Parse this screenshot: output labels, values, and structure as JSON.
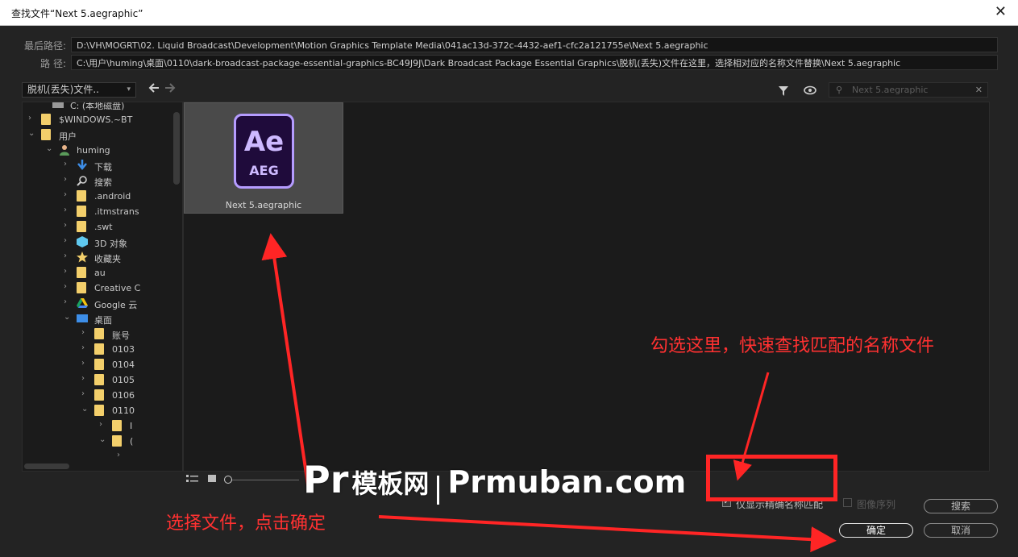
{
  "window": {
    "title": "查找文件“Next 5.aegraphic”",
    "close_glyph": "✕"
  },
  "paths": {
    "last_path_label": "最后路径:",
    "last_path_value": "D:\\VH\\MOGRT\\02. Liquid Broadcast\\Development\\Motion Graphics Template Media\\041ac13d-372c-4432-aef1-cfc2a121755e\\Next 5.aegraphic",
    "path_label": "路 径:",
    "path_value": "C:\\用户\\huming\\桌面\\0110\\dark-broadcast-package-essential-graphics-BC49J9J\\Dark Broadcast Package Essential Graphics\\脱机(丢失)文件在这里，选择相对应的名称文件替换\\Next 5.aegraphic"
  },
  "location_select": {
    "value": "脱机(丢失)文件..",
    "caret": "▾"
  },
  "nav": {
    "back": "🡐",
    "forward": "🡒"
  },
  "toolbar": {
    "filter_icon": "filter-icon",
    "view_icon": "eye-icon"
  },
  "search": {
    "placeholder": "Next 5.aegraphic",
    "clear_glyph": "✕",
    "icon": "⚲"
  },
  "tree": {
    "items": [
      {
        "label": "C: (本地磁盘)",
        "chevron": "",
        "icon": "drive"
      },
      {
        "label": "$WINDOWS.~BT",
        "chevron": "›",
        "icon": "folder"
      },
      {
        "label": "用户",
        "chevron": "⌄",
        "icon": "folder"
      },
      {
        "label": "huming",
        "chevron": "⌄",
        "icon": "user"
      },
      {
        "label": "下载",
        "chevron": "›",
        "icon": "download"
      },
      {
        "label": "搜索",
        "chevron": "›",
        "icon": "search"
      },
      {
        "label": ".android",
        "chevron": "›",
        "icon": "folder"
      },
      {
        "label": ".itmstrans",
        "chevron": "›",
        "icon": "folder"
      },
      {
        "label": ".swt",
        "chevron": "›",
        "icon": "folder"
      },
      {
        "label": "3D 对象",
        "chevron": "›",
        "icon": "cube"
      },
      {
        "label": "收藏夹",
        "chevron": "›",
        "icon": "star"
      },
      {
        "label": "au",
        "chevron": "›",
        "icon": "folder"
      },
      {
        "label": "Creative C",
        "chevron": "›",
        "icon": "folder"
      },
      {
        "label": "Google 云",
        "chevron": "›",
        "icon": "drive-google"
      },
      {
        "label": "桌面",
        "chevron": "⌄",
        "icon": "desktop"
      },
      {
        "label": "账号",
        "chevron": "›",
        "icon": "folder"
      },
      {
        "label": "0103",
        "chevron": "›",
        "icon": "folder"
      },
      {
        "label": "0104",
        "chevron": "›",
        "icon": "folder"
      },
      {
        "label": "0105",
        "chevron": "›",
        "icon": "folder"
      },
      {
        "label": "0106",
        "chevron": "›",
        "icon": "folder"
      },
      {
        "label": "0110",
        "chevron": "⌄",
        "icon": "folder"
      },
      {
        "label": "I",
        "chevron": "›",
        "icon": "folder"
      },
      {
        "label": "(",
        "chevron": "⌄",
        "icon": "folder"
      },
      {
        "label": "",
        "chevron": "›",
        "icon": ""
      }
    ]
  },
  "file": {
    "name": "Next 5.aegraphic",
    "icon_top": "Ae",
    "icon_bottom": "AEG"
  },
  "options": {
    "exact_match_label": "仅显示精确名称匹配",
    "exact_match_checked": true,
    "image_sequence_label": "图像序列",
    "image_sequence_checked": false
  },
  "buttons": {
    "search": "搜索",
    "ok": "确定",
    "cancel": "取消"
  },
  "annotations": {
    "check_hint": "勾选这里，快速查找匹配的名称文件",
    "select_hint": "选择文件，点击确定"
  },
  "watermark": {
    "pr": "Pr",
    "cn": "模板网",
    "domain": "Prmuban.com"
  },
  "colors": {
    "annotation_red": "#ff3131",
    "folder_yellow": "#f3cf6b",
    "ae_purple": "#b59cff"
  }
}
